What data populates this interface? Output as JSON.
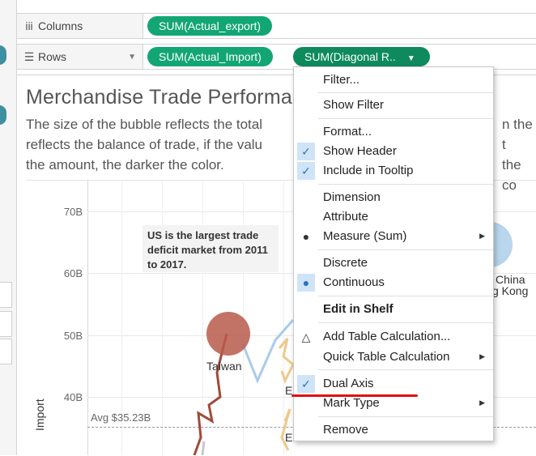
{
  "shelves": {
    "columns": {
      "label": "Columns",
      "icon": "iii",
      "pills": [
        "SUM(Actual_export)"
      ]
    },
    "rows": {
      "label": "Rows",
      "icon": "☰",
      "pills": [
        "SUM(Actual_Import)",
        "SUM(Diagonal R.."
      ]
    }
  },
  "view": {
    "title": "Merchandise Trade Performa",
    "subtitle_lines": [
      "The size of the bubble reflects the total",
      "reflects the balance of trade, if the valu",
      "the amount, the darker the color."
    ],
    "subtitle_right_lines": [
      "n the t",
      "the co"
    ],
    "y_axis_title": "Import",
    "y_ticks": [
      "70B",
      "60B",
      "50B",
      "40B"
    ],
    "avg_label": "Avg $35.23B",
    "annotation": [
      "US is the largest trade",
      "deficit market from 2011",
      "to 2017."
    ],
    "mark_labels": {
      "taiwan": "Taiwan",
      "china": "China",
      "hong_kong": "g Kong",
      "e1": "E",
      "e2": "E"
    }
  },
  "menu": {
    "items": {
      "filter": "Filter...",
      "show_filter": "Show Filter",
      "format": "Format...",
      "show_header": "Show Header",
      "include_tooltip": "Include in Tooltip",
      "dimension": "Dimension",
      "attribute": "Attribute",
      "measure": "Measure (Sum)",
      "discrete": "Discrete",
      "continuous": "Continuous",
      "edit_in_shelf": "Edit in Shelf",
      "add_table_calc": "Add Table Calculation...",
      "quick_table_calc": "Quick Table Calculation",
      "dual_axis": "Dual Axis",
      "mark_type": "Mark Type",
      "remove": "Remove"
    },
    "checked": {
      "show_header": true,
      "include_tooltip": true,
      "measure": true,
      "continuous": true,
      "dual_axis": true
    }
  },
  "colors": {
    "pill": "#13a675",
    "pill_active": "#0e8a5e",
    "check_bg": "#cfe4f7",
    "highlight": "#e01010",
    "taiwan_bubble": "#b85a4a",
    "taiwan_line": "#a14a3a",
    "china_bubble": "#a9cce8",
    "us_line": "#a9cce8",
    "eu_line": "#f0c88a"
  }
}
